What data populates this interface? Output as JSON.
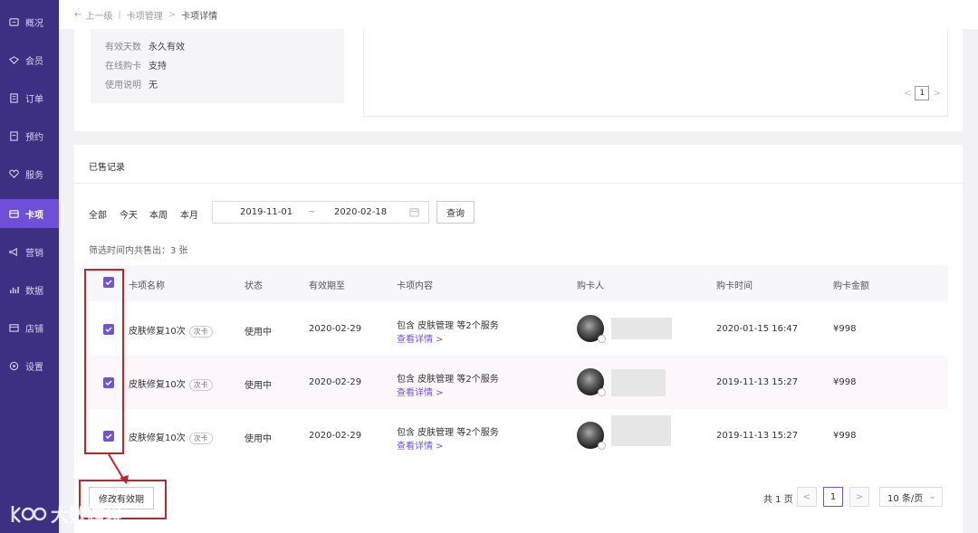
{
  "sidebar": {
    "items": [
      {
        "label": "概况",
        "icon": "overview-icon"
      },
      {
        "label": "会员",
        "icon": "member-icon"
      },
      {
        "label": "订单",
        "icon": "order-icon"
      },
      {
        "label": "预约",
        "icon": "booking-icon"
      },
      {
        "label": "服务",
        "icon": "service-icon"
      },
      {
        "label": "卡项",
        "icon": "card-icon",
        "active": true
      },
      {
        "label": "营销",
        "icon": "marketing-icon"
      },
      {
        "label": "数据",
        "icon": "data-icon"
      },
      {
        "label": "店铺",
        "icon": "shop-icon"
      },
      {
        "label": "设置",
        "icon": "settings-icon"
      }
    ]
  },
  "breadcrumb": {
    "back": "上一级",
    "parent": "卡项管理",
    "current": "卡项详情"
  },
  "card_info": {
    "rows": [
      {
        "key": "有效天数",
        "value": "永久有效"
      },
      {
        "key": "在线购卡",
        "value": "支持"
      },
      {
        "key": "使用说明",
        "value": "无"
      }
    ],
    "mini_page": "1"
  },
  "sold": {
    "title": "已售记录",
    "filters": [
      "全部",
      "今天",
      "本周",
      "本月"
    ],
    "date_start": "2019-11-01",
    "date_sep": "~",
    "date_end": "2020-02-18",
    "query_label": "查询",
    "summary": "筛选时间内共售出：3 张",
    "columns": [
      "卡项名称",
      "状态",
      "有效期至",
      "卡项内容",
      "购卡人",
      "购卡时间",
      "购卡金额"
    ],
    "rows": [
      {
        "name": "皮肤修复10次",
        "tag": "次卡",
        "status": "使用中",
        "expiry": "2020-02-29",
        "content": "包含 皮肤管理 等2个服务",
        "detail": "查看详情 >",
        "time": "2020-01-15 16:47",
        "amount": "¥998",
        "checked": true
      },
      {
        "name": "皮肤修复10次",
        "tag": "次卡",
        "status": "使用中",
        "expiry": "2020-02-29",
        "content": "包含 皮肤管理 等2个服务",
        "detail": "查看详情 >",
        "time": "2019-11-13 15:27",
        "amount": "¥998",
        "checked": true
      },
      {
        "name": "皮肤修复10次",
        "tag": "次卡",
        "status": "使用中",
        "expiry": "2020-02-29",
        "content": "包含 皮肤管理 等2个服务",
        "detail": "查看详情 >",
        "time": "2019-11-13 15:27",
        "amount": "¥998",
        "checked": true
      }
    ],
    "modify_label": "修改有效期",
    "total_pages": "共 1 页",
    "current_page": "1",
    "page_size": "10 条/页"
  },
  "watermark": "大数跨境",
  "colors": {
    "sidebar": "#3d2f82",
    "active": "#6e4fd8",
    "accent": "#7254cf",
    "annotation": "#b8282e"
  }
}
